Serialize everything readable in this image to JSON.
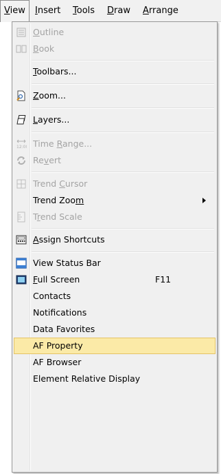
{
  "menubar": {
    "items": [
      {
        "pre": "",
        "mn": "V",
        "post": "iew"
      },
      {
        "pre": "",
        "mn": "I",
        "post": "nsert"
      },
      {
        "pre": "",
        "mn": "T",
        "post": "ools"
      },
      {
        "pre": "",
        "mn": "D",
        "post": "raw"
      },
      {
        "pre": "",
        "mn": "A",
        "post": "rrange"
      }
    ]
  },
  "menu": {
    "outline": {
      "pre": "",
      "mn": "O",
      "post": "utline"
    },
    "book": {
      "pre": "",
      "mn": "B",
      "post": "ook"
    },
    "toolbars": {
      "pre": "",
      "mn": "T",
      "post": "oolbars..."
    },
    "zoom": {
      "pre": "",
      "mn": "Z",
      "post": "oom..."
    },
    "layers": {
      "pre": "",
      "mn": "L",
      "post": "ayers..."
    },
    "time_range": {
      "pre": "Time ",
      "mn": "R",
      "post": "ange..."
    },
    "revert": {
      "pre": "Re",
      "mn": "v",
      "post": "ert"
    },
    "trend_cursor": {
      "pre": "Trend ",
      "mn": "C",
      "post": "ursor"
    },
    "trend_zoom": {
      "pre": "Trend Zoo",
      "mn": "m",
      "post": ""
    },
    "trend_scale": {
      "pre": "T",
      "mn": "r",
      "post": "end Scale"
    },
    "assign_shortcuts": {
      "pre": "",
      "mn": "A",
      "post": "ssign Shortcuts"
    },
    "view_status_bar": "View Status Bar",
    "full_screen": {
      "pre": "",
      "mn": "F",
      "post": "ull Screen"
    },
    "full_screen_accel": "F11",
    "contacts": "Contacts",
    "notifications": "Notifications",
    "data_favorites": "Data Favorites",
    "af_property": "AF Property",
    "af_browser": "AF Browser",
    "element_relative_display": "Element Relative Display"
  },
  "colors": {
    "highlight": "#fbeaa7",
    "disabled_text": "#a3a3a3"
  }
}
